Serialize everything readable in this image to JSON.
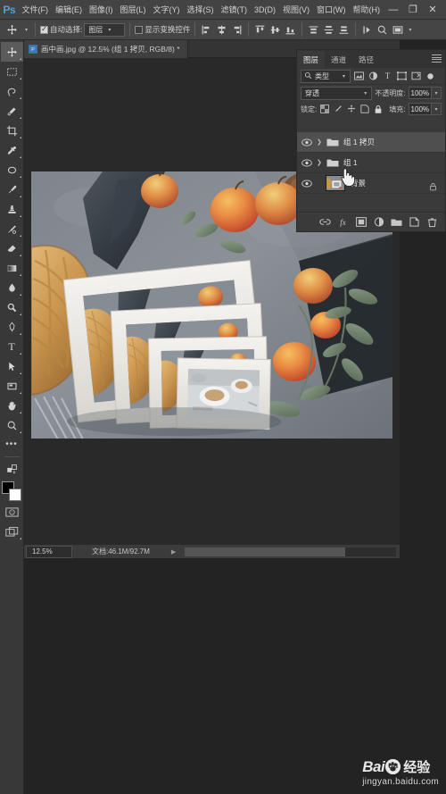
{
  "app": {
    "name": "Adobe Photoshop",
    "logo": "Ps"
  },
  "menubar": {
    "items": [
      {
        "label": "文件(F)",
        "name": "menu-file"
      },
      {
        "label": "编辑(E)",
        "name": "menu-edit"
      },
      {
        "label": "图像(I)",
        "name": "menu-image"
      },
      {
        "label": "图层(L)",
        "name": "menu-layer"
      },
      {
        "label": "文字(Y)",
        "name": "menu-type"
      },
      {
        "label": "选择(S)",
        "name": "menu-select"
      },
      {
        "label": "滤镜(T)",
        "name": "menu-filter"
      },
      {
        "label": "3D(D)",
        "name": "menu-3d"
      },
      {
        "label": "视图(V)",
        "name": "menu-view"
      },
      {
        "label": "窗口(W)",
        "name": "menu-window"
      },
      {
        "label": "帮助(H)",
        "name": "menu-help"
      }
    ],
    "window_controls": {
      "minimize": "—",
      "restore": "❐",
      "close": "✕"
    }
  },
  "options_bar": {
    "tool_icon": "move-tool-icon",
    "auto_select_checked": true,
    "auto_select_label": "自动选择:",
    "auto_select_value": "图层",
    "show_transform_checked": false,
    "show_transform_label": "显示变换控件",
    "align_icons": [
      "align-left-edges",
      "align-horizontal-centers",
      "align-right-edges",
      "align-top-edges",
      "align-vertical-centers",
      "align-bottom-edges",
      "distribute-top",
      "distribute-vertical-center",
      "distribute-bottom"
    ],
    "extra_icons": [
      "more-options-icon",
      "search-icon",
      "workspace-icon"
    ]
  },
  "toolbar": {
    "tools": [
      {
        "name": "move-tool",
        "glyph": "✥",
        "selected": true
      },
      {
        "name": "marquee-tool",
        "glyph": "▭",
        "selected": false
      },
      {
        "name": "lasso-tool",
        "glyph": "⌇",
        "selected": false
      },
      {
        "name": "quick-selection-tool",
        "glyph": "✎",
        "selected": false
      },
      {
        "name": "crop-tool",
        "glyph": "⌗",
        "selected": false
      },
      {
        "name": "eyedropper-tool",
        "glyph": "⚲",
        "selected": false
      },
      {
        "name": "healing-brush-tool",
        "glyph": "◯",
        "selected": false
      },
      {
        "name": "brush-tool",
        "glyph": "✑",
        "selected": false
      },
      {
        "name": "clone-stamp-tool",
        "glyph": "♠",
        "selected": false
      },
      {
        "name": "history-brush-tool",
        "glyph": "✂",
        "selected": false
      },
      {
        "name": "eraser-tool",
        "glyph": "◤",
        "selected": false
      },
      {
        "name": "gradient-tool",
        "glyph": "▤",
        "selected": false
      },
      {
        "name": "blur-tool",
        "glyph": "💧",
        "selected": false
      },
      {
        "name": "dodge-tool",
        "glyph": "◕",
        "selected": false
      },
      {
        "name": "pen-tool",
        "glyph": "✒",
        "selected": false
      },
      {
        "name": "type-tool",
        "glyph": "T",
        "selected": false
      },
      {
        "name": "path-selection-tool",
        "glyph": "➤",
        "selected": false
      },
      {
        "name": "rectangle-tool",
        "glyph": "▢",
        "selected": false
      },
      {
        "name": "hand-tool",
        "glyph": "✋",
        "selected": false
      },
      {
        "name": "zoom-tool",
        "glyph": "🔍",
        "selected": false
      },
      {
        "name": "more-tools",
        "glyph": "•••",
        "selected": false
      }
    ],
    "foreground_color": "#000000",
    "background_color": "#ffffff",
    "quick_mask_icon": "quick-mask-icon",
    "screen_mode_icon": "screen-mode-icon"
  },
  "document": {
    "tab_title": "画中画.jpg @ 12.5% (组 1 拷贝, RGB/8) *",
    "zoom_level": "12.5%",
    "doc_info": "文档:46.1M/92.7M",
    "status_arrow": "▶"
  },
  "panel": {
    "tabs": [
      {
        "label": "图层",
        "active": true,
        "name": "tab-layers"
      },
      {
        "label": "通道",
        "active": false,
        "name": "tab-channels"
      },
      {
        "label": "路径",
        "active": false,
        "name": "tab-paths"
      }
    ],
    "filter": {
      "search_icon": "search-icon",
      "kind_label": "类型",
      "filter_icons": [
        "filter-pixel-icon",
        "filter-adjustment-icon",
        "filter-type-icon",
        "filter-shape-icon",
        "filter-smart-icon"
      ],
      "toggle_icon": "filter-toggle-icon"
    },
    "blend": {
      "mode": "穿透",
      "opacity_label": "不透明度:",
      "opacity_value": "100%"
    },
    "lock": {
      "label": "锁定:",
      "icons": [
        "lock-transparency-icon",
        "lock-image-icon",
        "lock-position-icon",
        "lock-artboard-icon",
        "lock-all-icon"
      ],
      "fill_label": "填充:",
      "fill_value": "100%"
    },
    "layers": [
      {
        "name": "组 1 拷贝",
        "type": "group",
        "visible": true,
        "selected": true,
        "expanded": false,
        "locked": false
      },
      {
        "name": "组 1",
        "type": "group",
        "visible": true,
        "selected": false,
        "expanded": false,
        "locked": false
      },
      {
        "name": "背景",
        "type": "image",
        "visible": true,
        "selected": false,
        "expanded": false,
        "locked": true
      }
    ],
    "footer_icons": [
      {
        "name": "link-layers-icon",
        "glyph": "⛓"
      },
      {
        "name": "layer-style-fx-icon",
        "glyph": "fx"
      },
      {
        "name": "layer-mask-icon",
        "glyph": "▣"
      },
      {
        "name": "adjustment-layer-icon",
        "glyph": "◑"
      },
      {
        "name": "new-group-icon",
        "glyph": "▬"
      },
      {
        "name": "new-layer-icon",
        "glyph": "❐"
      },
      {
        "name": "delete-layer-icon",
        "glyph": "🗑"
      }
    ]
  },
  "cursor": {
    "type": "pointing-hand-cursor"
  },
  "watermark": {
    "brand_bai": "Bai",
    "brand_du": "du",
    "brand_suffix": "经验",
    "url": "jingyan.baidu.com"
  }
}
